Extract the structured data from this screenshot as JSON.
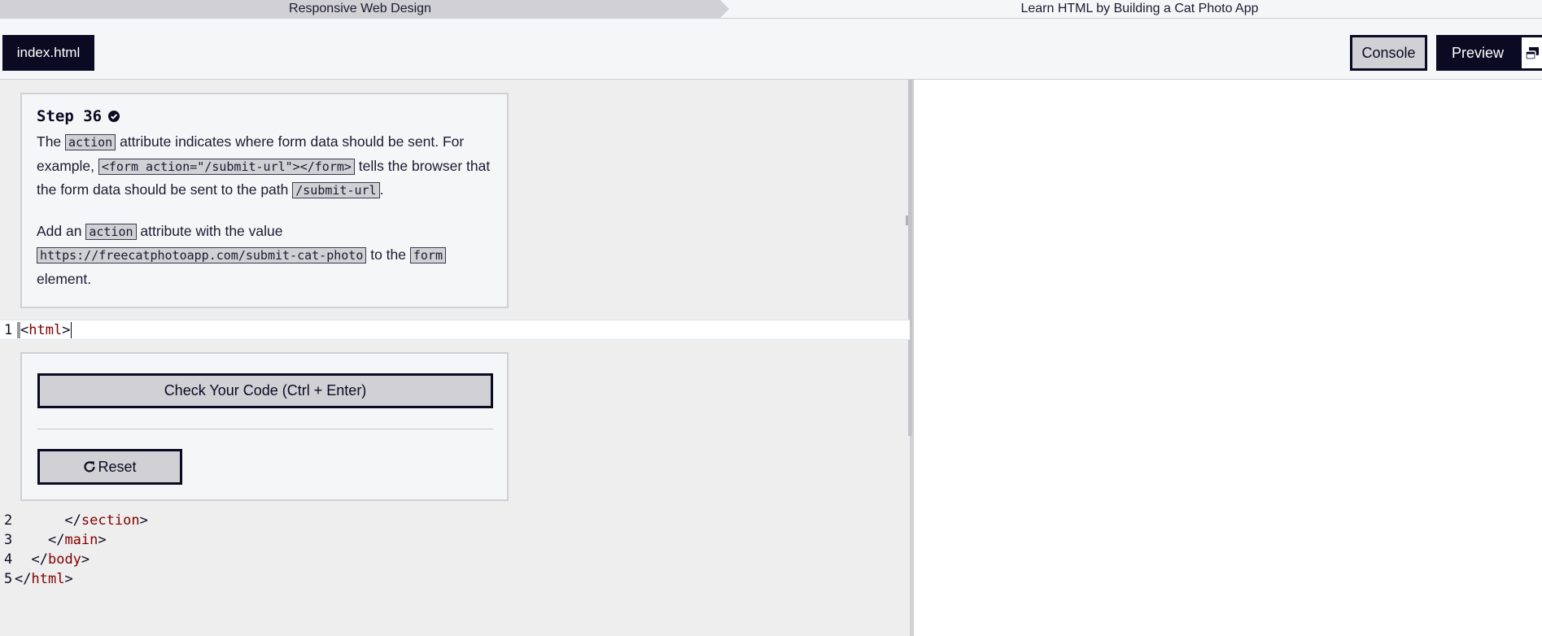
{
  "breadcrumb": {
    "course": "Responsive Web Design",
    "project": "Learn HTML by Building a Cat Photo App"
  },
  "toolbar": {
    "file_tab": "index.html",
    "console_label": "Console",
    "preview_label": "Preview"
  },
  "description": {
    "step_title": "Step 36",
    "p1_a": "The ",
    "p1_code1": "action",
    "p1_b": " attribute indicates where form data should be sent. For example, ",
    "p1_code2": "<form action=\"/submit-url\"></form>",
    "p1_c": " tells the browser that the form data should be sent to the path ",
    "p1_code3": "/submit-url",
    "p1_d": ".",
    "p2_a": "Add an ",
    "p2_code1": "action",
    "p2_b": " attribute with the value ",
    "p2_code2": "https://freecatphotoapp.com/submit-cat-photo",
    "p2_c": " to the ",
    "p2_code3": "form",
    "p2_d": " element."
  },
  "editor": {
    "active_line": {
      "num": "1",
      "open": "<",
      "tag": "html",
      "close": ">"
    },
    "lines": [
      {
        "num": "2",
        "indent": "      ",
        "open": "</",
        "tag": "section",
        "close": ">"
      },
      {
        "num": "3",
        "indent": "    ",
        "open": "</",
        "tag": "main",
        "close": ">"
      },
      {
        "num": "4",
        "indent": "  ",
        "open": "</",
        "tag": "body",
        "close": ">"
      },
      {
        "num": "5",
        "indent": "",
        "open": "</",
        "tag": "html",
        "close": ">"
      }
    ]
  },
  "actions": {
    "check_label": "Check Your Code (Ctrl + Enter)",
    "reset_label": "Reset"
  },
  "colors": {
    "dark": "#0a0a23",
    "gray": "#d0d0d5",
    "panel": "#f5f6f7",
    "editor_bg": "#eeeeee",
    "tag": "#800000"
  },
  "icons": [
    "check-circle-icon",
    "popout-icon",
    "reset-icon"
  ]
}
